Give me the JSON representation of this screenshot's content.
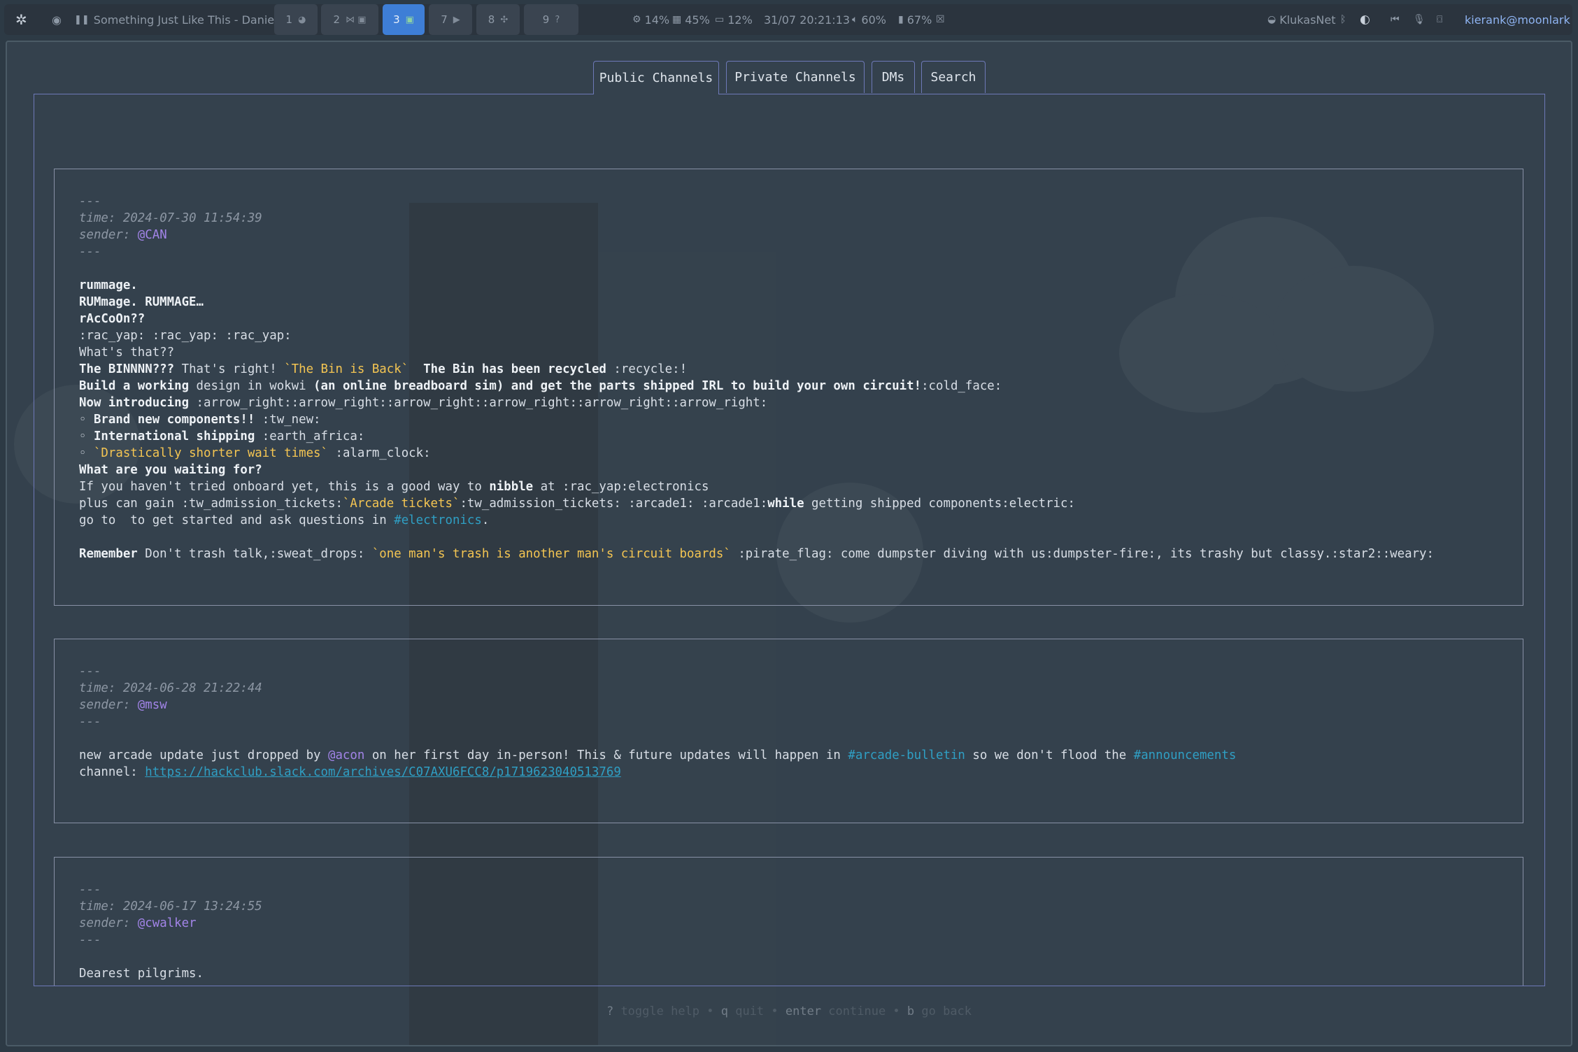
{
  "topbar": {
    "now_playing": "Something Just Like This - Daniel…",
    "workspaces": [
      {
        "num": "1",
        "glyph": "◕"
      },
      {
        "num": "2",
        "glyph": "⋈ ▣"
      },
      {
        "num": "3",
        "glyph": "▣"
      },
      {
        "num": "7",
        "glyph": "▶"
      },
      {
        "num": "8",
        "glyph": "✣"
      },
      {
        "num": "9",
        "glyph": "?"
      }
    ],
    "cpu": "14%",
    "memory": "45%",
    "disk": "12%",
    "datetime": "31/07 20:21:13",
    "volume": "60%",
    "battery": "67%",
    "network": "KlukasNet",
    "user": "kierank@moonlark"
  },
  "tabs": [
    "Public Channels",
    "Private Channels",
    "DMs",
    "Search"
  ],
  "messages": [
    {
      "divider": "---",
      "time_label": "time:",
      "time": "2024-07-30 11:54:39",
      "sender_label": "sender:",
      "sender": "@CAN",
      "lines": {
        "l1": "rummage.",
        "l2": "RUMmage. RUMMAGE…",
        "l3": "rAcCoOn??",
        "l4": ":rac_yap: :rac_yap: :rac_yap:",
        "l5": "What's that??",
        "l6a": "The BINNNN???",
        "l6b": " That's right! ",
        "l6c": "`The Bin is Back`",
        "l6d": "  ",
        "l6e": "The Bin has been recycled",
        "l6f": " :recycle:!",
        "l7a": "Build a working",
        "l7b": " design in wokwi ",
        "l7c": "(an online breadboard sim) and get the parts shipped IRL to build your own circuit!",
        "l7d": ":cold_face:",
        "l8a": "Now introducing",
        "l8b": " :arrow_right::arrow_right::arrow_right::arrow_right::arrow_right::arrow_right:",
        "l9a": "◦ ",
        "l9b": "Brand new components!!",
        "l9c": " :tw_new:",
        "l10a": "◦ ",
        "l10b": "International shipping",
        "l10c": " :earth_africa:",
        "l11a": "◦ ",
        "l11b": "`Drastically shorter wait times`",
        "l11c": " :alarm_clock:",
        "l12": "What are you waiting for?",
        "l13a": "If you haven't tried onboard yet, this is a good way to ",
        "l13b": "nibble",
        "l13c": " at :rac_yap:electronics",
        "l14a": "plus can gain :tw_admission_tickets:",
        "l14b": "`Arcade tickets`",
        "l14c": ":tw_admission_tickets: :arcade1: :arcade1:",
        "l14d": "while",
        "l14e": " getting shipped components:electric:",
        "l15a": "go to  to get started and ask questions in ",
        "l15b": "#electronics",
        "l15c": ".",
        "l16a": "Remember",
        "l16b": " Don't trash talk,:sweat_drops: ",
        "l16c": "`one man's trash is another man's circuit boards`",
        "l16d": " :pirate_flag: come dumpster diving with us:dumpster-fire:, its trashy but classy.:star2::weary:"
      }
    },
    {
      "divider": "---",
      "time_label": "time:",
      "time": "2024-06-28 21:22:44",
      "sender_label": "sender:",
      "sender": "@msw",
      "lines": {
        "l1a": "new arcade update just dropped by ",
        "l1b": "@acon",
        "l1c": " on her first day in-person! This & future updates will happen in ",
        "l1d": "#arcade-bulletin",
        "l1e": " so we don't flood the ",
        "l1f": "#announcements",
        "l2a": "channel: ",
        "l2b": "https://hackclub.slack.com/archives/C07AXU6FCC8/p1719623040513769"
      }
    },
    {
      "divider": "---",
      "time_label": "time:",
      "time": "2024-06-17 13:24:55",
      "sender_label": "sender:",
      "sender": "@cwalker",
      "lines": {
        "l1": "Dearest pilgrims."
      }
    }
  ],
  "footer": {
    "k1": "?",
    "t1": " toggle help • ",
    "k2": "q",
    "t2": " quit • ",
    "k3": "enter",
    "t3": " continue • ",
    "k4": "b",
    "t4": " go back"
  },
  "colors": {
    "accent": "#3e7ed6",
    "border": "#6e79b8",
    "mention": "#a284e8",
    "channel": "#2f9fc4",
    "code": "#f4c552"
  }
}
